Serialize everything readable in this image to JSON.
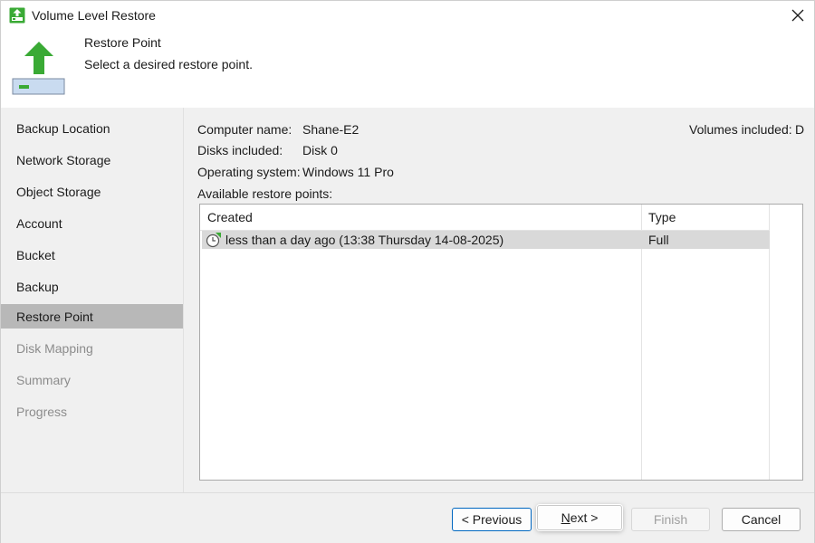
{
  "window": {
    "title": "Volume Level Restore"
  },
  "header": {
    "title": "Restore Point",
    "subtitle": "Select a desired restore point."
  },
  "sidebar": {
    "items": [
      {
        "label": "Backup Location",
        "state": "normal"
      },
      {
        "label": "Network Storage",
        "state": "normal"
      },
      {
        "label": "Object Storage",
        "state": "normal"
      },
      {
        "label": "Account",
        "state": "normal"
      },
      {
        "label": "Bucket",
        "state": "normal"
      },
      {
        "label": "Backup",
        "state": "normal"
      },
      {
        "label": "Restore Point",
        "state": "active"
      },
      {
        "label": "Disk Mapping",
        "state": "disabled"
      },
      {
        "label": "Summary",
        "state": "disabled"
      },
      {
        "label": "Progress",
        "state": "disabled"
      }
    ]
  },
  "info": {
    "computer_name_label": "Computer name:",
    "computer_name_value": "Shane-E2",
    "disks_label": "Disks included:",
    "disks_value": "Disk 0",
    "os_label": "Operating system:",
    "os_value": "Windows 11 Pro",
    "volumes_label": "Volumes included:",
    "volumes_value": "D",
    "restore_points_label": "Available restore points:"
  },
  "grid": {
    "columns": [
      "Created",
      "Type"
    ],
    "rows": [
      {
        "created": "less than a day ago (13:38 Thursday 14-08-2025)",
        "type": "Full",
        "icon": "restore-point-clock-icon",
        "selected": true
      }
    ]
  },
  "footer": {
    "previous_label": "< Previous",
    "next_prefix": "N",
    "next_suffix": "ext >",
    "finish_label": "Finish",
    "cancel_label": "Cancel"
  },
  "colors": {
    "accent_green": "#3aaa35",
    "selection_gray": "#d9d9d9",
    "active_nav": "#b8b8b8",
    "focus_blue": "#0067c0"
  }
}
